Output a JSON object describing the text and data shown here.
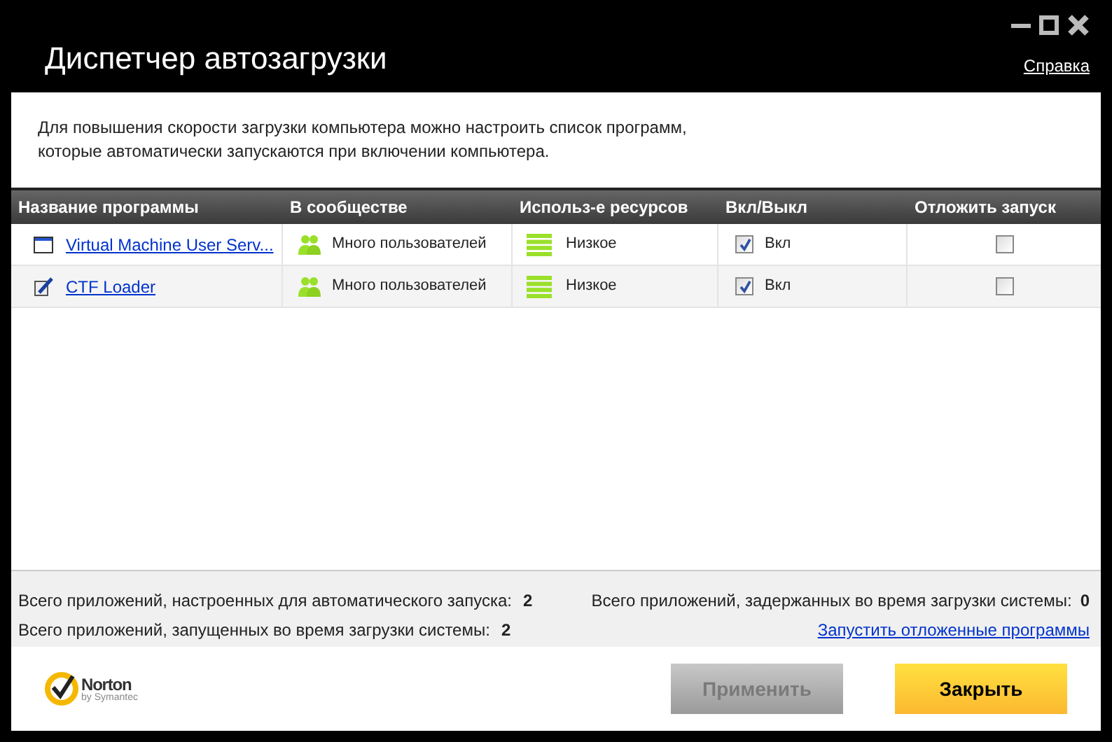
{
  "window": {
    "title": "Диспетчер автозагрузки",
    "help_link": "Справка"
  },
  "description": "Для повышения скорости загрузки компьютера можно настроить список программ,\nкоторые автоматически запускаются при включении компьютера.",
  "table": {
    "columns": [
      "Название программы",
      "В сообществе",
      "Использ-е ресурсов",
      "Вкл/Выкл",
      "Отложить запуск"
    ],
    "rows": [
      {
        "name": "Virtual Machine User Serv...",
        "kind": "window",
        "community": "Много пользователей",
        "resources": "Низкое",
        "enabled": true,
        "enabled_label": "Вкл",
        "delayed": false
      },
      {
        "name": "CTF Loader",
        "kind": "pen",
        "community": "Много пользователей",
        "resources": "Низкое",
        "enabled": true,
        "enabled_label": "Вкл",
        "delayed": false
      }
    ]
  },
  "summary": {
    "autostart_label": "Всего приложений, настроенных для автоматического запуска:",
    "autostart_count": "2",
    "started_label": "Всего приложений, запущенных во время загрузки системы:",
    "started_count": "2",
    "delayed_label": "Всего приложений, задержанных во время загрузки системы:",
    "delayed_count": "0",
    "run_delayed_link": "Запустить отложенные программы"
  },
  "logo": {
    "name": "Norton",
    "sub": "by Symantec"
  },
  "buttons": [
    {
      "label": "Применить",
      "kind": "secondary",
      "disabled": true
    },
    {
      "label": "Закрыть",
      "kind": "primary",
      "disabled": false
    }
  ]
}
